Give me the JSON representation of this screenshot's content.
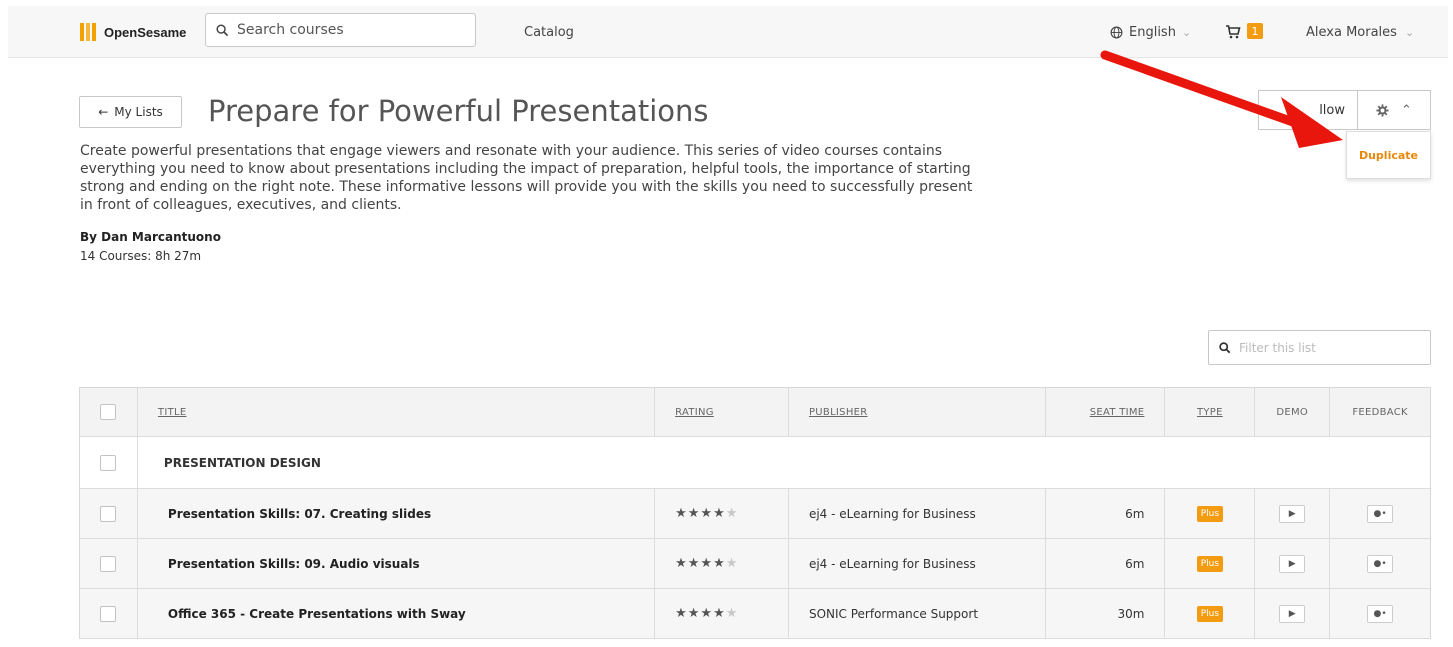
{
  "header": {
    "logo_text": "OpenSesame",
    "search_placeholder": "Search courses",
    "catalog_label": "Catalog",
    "language_label": "English",
    "cart_count": "1",
    "user_name": "Alexa Morales"
  },
  "page": {
    "back_label": "My Lists",
    "title": "Prepare for Powerful Presentations",
    "description": "Create powerful presentations that engage viewers and resonate with your audience. This series of video courses contains everything you need to know about presentations including the impact of preparation, helpful tools, the importance of starting strong and ending on the right note. These informative lessons will provide you with the skills you need to successfully present in front of colleagues, executives, and clients.",
    "author": "By Dan Marcantuono",
    "course_count": "14 Courses: 8h 27m",
    "follow_label": "llow",
    "dropdown_item": "Duplicate"
  },
  "filter": {
    "placeholder": "Filter this list"
  },
  "table": {
    "headers": {
      "title": "TITLE",
      "rating": "RATING",
      "publisher": "PUBLISHER",
      "seat_time": "SEAT TIME",
      "type": "TYPE",
      "demo": "DEMO",
      "feedback": "FEEDBACK"
    },
    "group_label": "PRESENTATION DESIGN",
    "rows": [
      {
        "title": "Presentation Skills: 07. Creating slides",
        "rating": 4,
        "publisher": "ej4 - eLearning for Business",
        "seat_time": "6m",
        "type": "Plus"
      },
      {
        "title": "Presentation Skills: 09. Audio visuals",
        "rating": 4.5,
        "publisher": "ej4 - eLearning for Business",
        "seat_time": "6m",
        "type": "Plus"
      },
      {
        "title": "Office 365 - Create Presentations with Sway",
        "rating": 4,
        "publisher": "SONIC Performance Support",
        "seat_time": "30m",
        "type": "Plus"
      }
    ]
  },
  "colors": {
    "accent": "#f39c12",
    "annotation_arrow": "#e8160c"
  },
  "icons": {
    "search": "search-icon",
    "globe": "globe-icon",
    "cart": "cart-icon",
    "gear": "gear-icon",
    "back": "arrow-left-icon"
  }
}
